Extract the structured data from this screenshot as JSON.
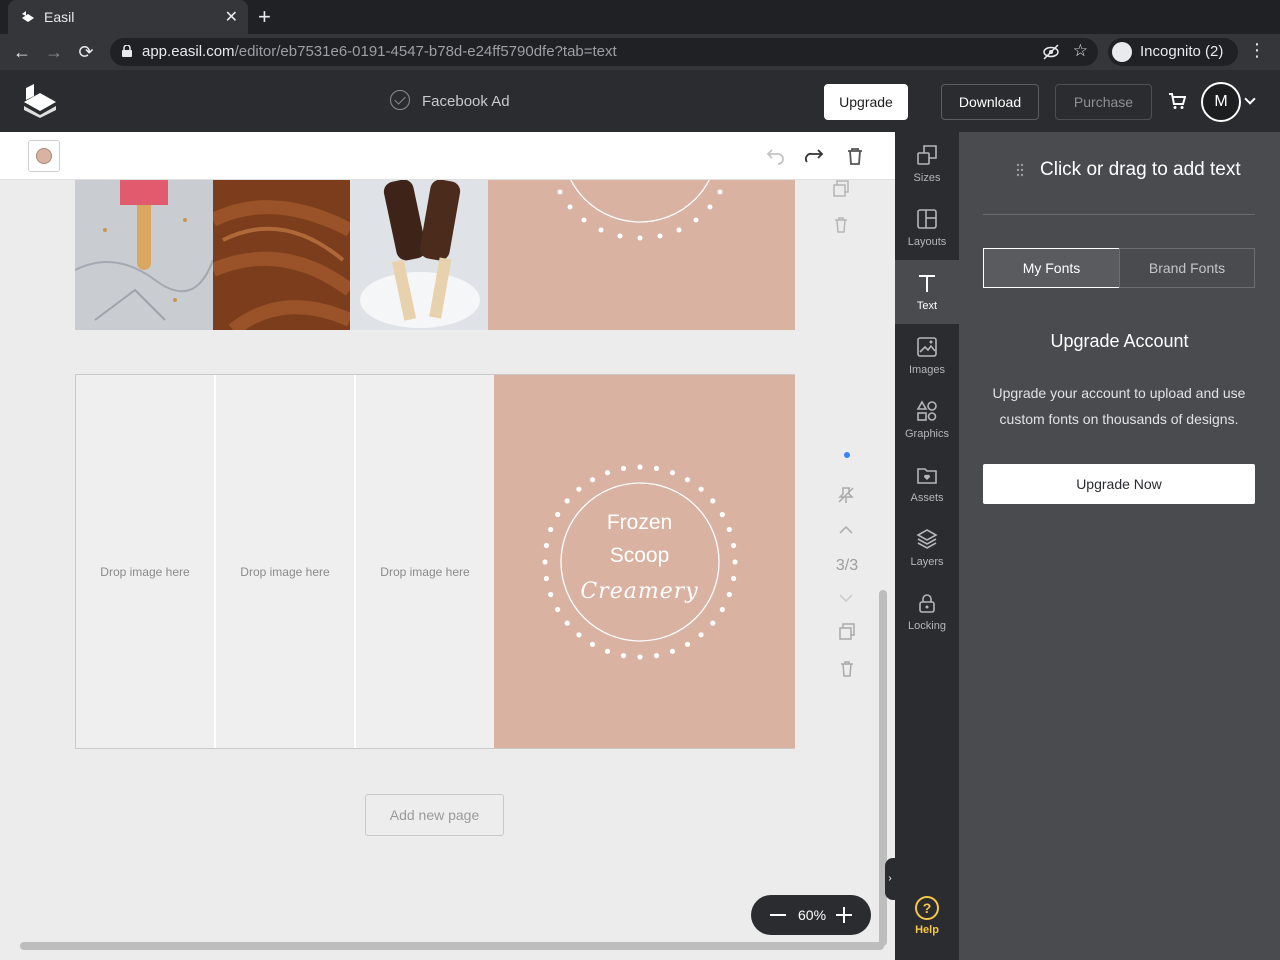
{
  "browser": {
    "tab_title": "Easil",
    "url_host": "app.easil.com",
    "url_path": "/editor/eb7531e6-0191-4547-b78d-e24ff5790dfe?tab=text",
    "incognito_label": "Incognito (2)"
  },
  "header": {
    "doc_title": "Facebook Ad",
    "upgrade_label": "Upgrade",
    "download_label": "Download",
    "purchase_label": "Purchase",
    "avatar_initial": "M"
  },
  "canvas": {
    "fill_color": "#d9b2a1",
    "drop_image_label": "Drop image here",
    "badge_line1": "Frozen",
    "badge_line2": "Scoop",
    "badge_line3": "Creamery",
    "page_indicator": "3/3",
    "add_page_label": "Add new page",
    "zoom_level": "60%"
  },
  "sidenav": {
    "items": [
      {
        "label": "Sizes",
        "icon": "sizes-icon"
      },
      {
        "label": "Layouts",
        "icon": "layouts-icon"
      },
      {
        "label": "Text",
        "icon": "text-icon"
      },
      {
        "label": "Images",
        "icon": "images-icon"
      },
      {
        "label": "Graphics",
        "icon": "graphics-icon"
      },
      {
        "label": "Assets",
        "icon": "assets-icon"
      },
      {
        "label": "Layers",
        "icon": "layers-icon"
      },
      {
        "label": "Locking",
        "icon": "lock-icon"
      }
    ],
    "active": "Text",
    "help_label": "Help"
  },
  "panel": {
    "title": "Click or drag to add text",
    "tab_my_fonts": "My Fonts",
    "tab_brand_fonts": "Brand Fonts",
    "heading": "Upgrade Account",
    "body": "Upgrade your account to upload and use custom fonts on thousands of designs.",
    "cta_label": "Upgrade Now"
  },
  "colors": {
    "accent_pink": "#d9b2a1",
    "dark_bg": "#2b2c2f",
    "panel_bg": "#4a4b4f",
    "help_yellow": "#f5c74a"
  }
}
